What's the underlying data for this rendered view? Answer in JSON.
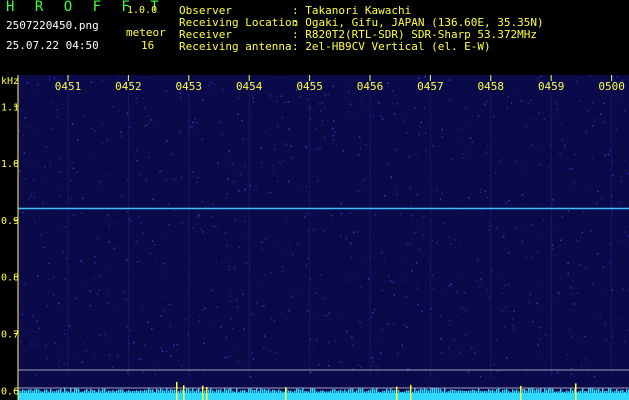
{
  "app": {
    "title": "H R O F F T",
    "version": "1.0.0",
    "filename": "2507220450.png",
    "datetime": "25.07.22 04:50",
    "mode_label": "meteor",
    "count": "16"
  },
  "info": {
    "observer_label": "Observer",
    "observer_value": ": Takanori Kawachi",
    "location_label": "Receiving Location",
    "location_value": ": Ogaki, Gifu, JAPAN (136.60E, 35.35N)",
    "receiver_label": "Receiver",
    "receiver_value": ": R820T2(RTL-SDR) SDR-Sharp 53.372MHz",
    "antenna_label": "Receiving antenna",
    "antenna_value": ": 2el-HB9CV Vertical (el. E-W)"
  },
  "plot": {
    "y_unit": "kHz",
    "time_ticks": [
      "0451",
      "0452",
      "0453",
      "0454",
      "0455",
      "0456",
      "0457",
      "0458",
      "0459",
      "0500"
    ],
    "freq_ticks": [
      "1.1",
      "1.0",
      "0.9",
      "0.8",
      "0.7",
      "0.6"
    ],
    "freq_range": [
      0.583,
      1.155
    ],
    "carrier_freq": 0.92,
    "colors": {
      "background": "#0a0a4a",
      "axis": "#ffff3f",
      "grid": "#1d1d7a",
      "carrier": "#3fbfff",
      "baseline": "#2fd8ff",
      "spikes": "#ffff3f",
      "hline": "#a0a0c0"
    }
  }
}
